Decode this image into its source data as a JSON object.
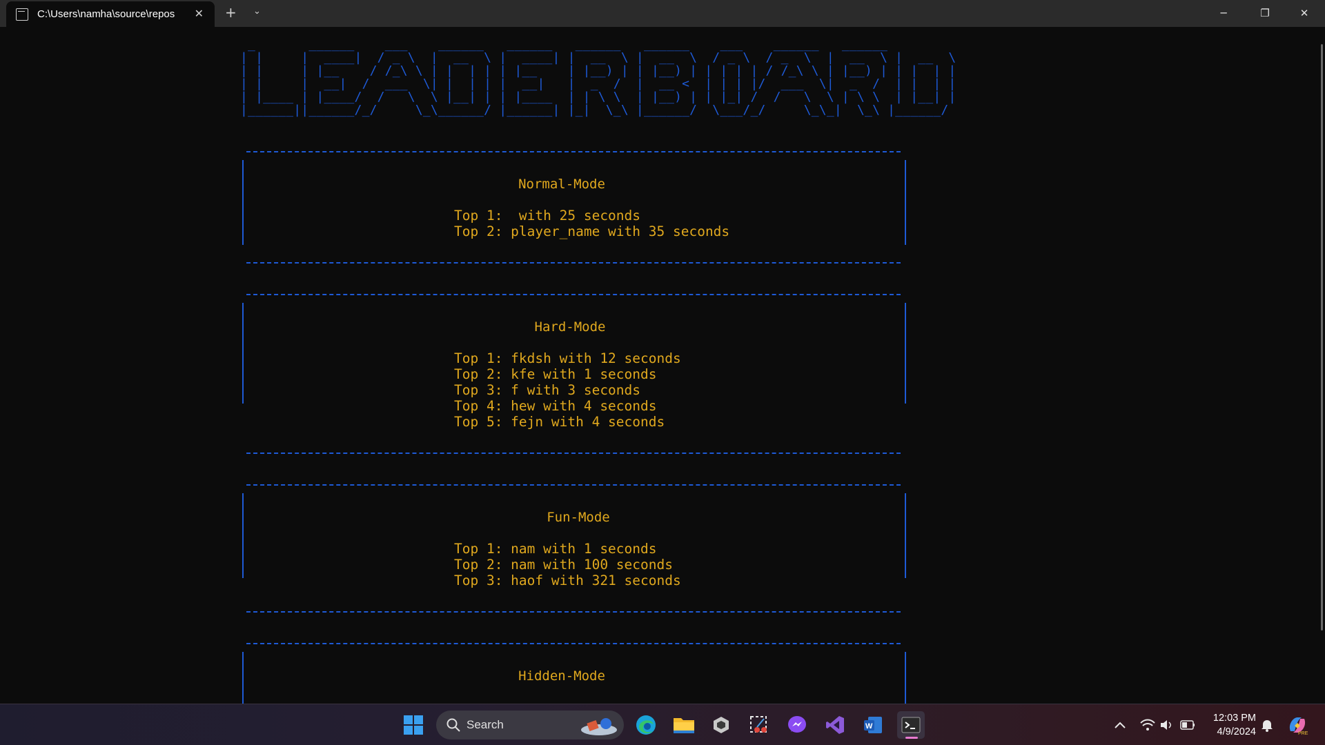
{
  "window": {
    "tab_title": "C:\\Users\\namha\\source\\repos",
    "tab_icon": "terminal-icon",
    "close_tab_glyph": "✕",
    "new_tab_glyph": "+",
    "dropdown_glyph": "⌄",
    "minimize_glyph": "─",
    "restore_glyph": "❐",
    "close_glyph": "✕"
  },
  "terminal": {
    "banner_ascii": " _       ______    ___    ______   ______   ______   ______    ___    ______   ______ \n| |     |  ____|  / _ \\  |  __  \\ |  ____| |  __  \\ |  __  \\  / _ \\  / _  \\  |  __  \\ |  __  \\\n| |     | |__    / /_\\ \\ | |  | | | |__    | |__) | | |__) | | | | | / /_\\ \\ | |__) | | |  | |\n| |     |  __|  /  ___  \\| |  | | |  __|   |  _  /  |  __ <  | | | |/  ___  \\|  _  /  | |  | |\n| |____ | |____/  /   \\  \\ |__| | | |____  | | \\ \\  | |__) | | |_| /  /   \\  \\ | \\ \\  | |__| |\n|______||______/_/     \\_\\______/ |______| |_|  \\_\\ |______/  \\___/_/     \\_\\_|  \\_\\ |______/",
    "sections": [
      {
        "title": "Normal-Mode",
        "entries": [
          "Top 1:  with 25 seconds",
          "Top 2: player_name with 35 seconds"
        ]
      },
      {
        "title": "Hard-Mode",
        "entries": [
          "Top 1: fkdsh with 12 seconds",
          "Top 2: kfe with 1 seconds",
          "Top 3: f with 3 seconds",
          "Top 4: hew with 4 seconds",
          "Top 5: fejn with 4 seconds"
        ]
      },
      {
        "title": "Fun-Mode",
        "entries": [
          "Top 1: nam with 1 seconds",
          "Top 2: nam with 100 seconds",
          "Top 3: haof with 321 seconds"
        ]
      },
      {
        "title": "Hidden-Mode",
        "entries": []
      }
    ]
  },
  "taskbar": {
    "search_placeholder": "Search",
    "apps": [
      "start-icon",
      "edge-icon",
      "file-explorer-icon",
      "unity-icon",
      "snipping-tool-icon",
      "messenger-icon",
      "visual-studio-icon",
      "word-icon",
      "terminal-icon"
    ],
    "clock_time": "12:03 PM",
    "clock_date": "4/9/2024"
  },
  "colors": {
    "terminal_bg": "#0c0c0c",
    "blue": "#1e5ad6",
    "yellow": "#e0a81e",
    "titlebar": "#2b2b2b"
  }
}
